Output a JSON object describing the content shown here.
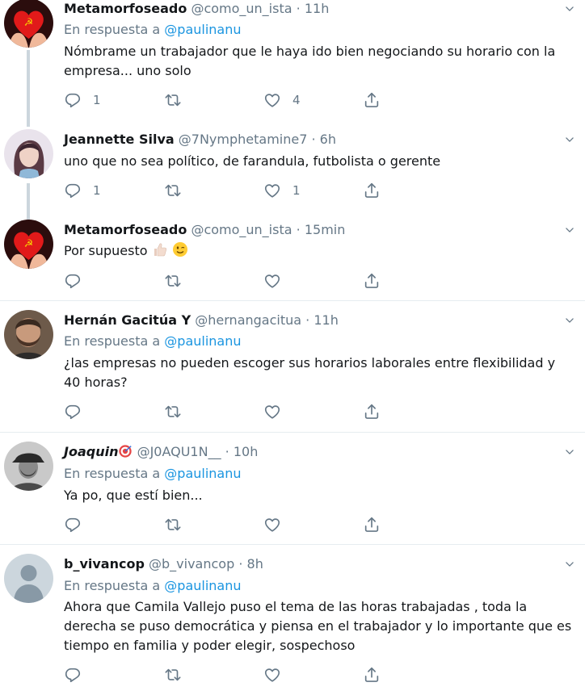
{
  "tweets": [
    {
      "name": "Metamorfoseado",
      "handle": "@como_un_ista",
      "dot": "·",
      "time": "11h",
      "reply_prefix": "En respuesta a",
      "reply_mention": "@paulinanu",
      "text": "Nómbrame un trabajador que le haya ido bien negociando su horario con la empresa... uno solo",
      "replies": "1",
      "retweets": "",
      "likes": "4"
    },
    {
      "name": "Jeannette Silva",
      "handle": "@7Nymphetamine7",
      "dot": "·",
      "time": "6h",
      "text": "uno que no sea político, de farandula, futbolista o gerente",
      "replies": "1",
      "retweets": "",
      "likes": "1"
    },
    {
      "name": "Metamorfoseado",
      "handle": "@como_un_ista",
      "dot": "·",
      "time": "15min",
      "text": "Por supuesto",
      "emojis": [
        "thumbs-up-emoji",
        "winking-face-emoji"
      ],
      "replies": "",
      "retweets": "",
      "likes": ""
    },
    {
      "name": "Hernán Gacitúa Y",
      "handle": "@hernangacitua",
      "dot": "·",
      "time": "11h",
      "reply_prefix": "En respuesta a",
      "reply_mention": "@paulinanu",
      "text": "¿las empresas no pueden escoger sus horarios laborales entre flexibilidad y 40 horas?",
      "replies": "",
      "retweets": "",
      "likes": ""
    },
    {
      "name": "Joaquin",
      "name_emoji": "target-emoji",
      "handle": "@J0AQU1N__",
      "dot": "·",
      "time": "10h",
      "reply_prefix": "En respuesta a",
      "reply_mention": "@paulinanu",
      "text": "Ya po, que estí bien...",
      "replies": "",
      "retweets": "",
      "likes": ""
    },
    {
      "name": "b_vivancop",
      "handle": "@b_vivancop",
      "dot": "·",
      "time": "8h",
      "reply_prefix": "En respuesta a",
      "reply_mention": "@paulinanu",
      "text": "Ahora que Camila Vallejo puso el tema de las horas trabajadas , toda la derecha se puso democrática y piensa en el trabajador y lo importante que es tiempo en familia y poder elegir, sospechoso",
      "replies": "",
      "retweets": "",
      "likes": ""
    }
  ],
  "icons": {
    "reply": "reply-icon",
    "retweet": "retweet-icon",
    "like": "heart-icon",
    "share": "share-icon",
    "caret": "chevron-down-icon"
  },
  "colors": {
    "text": "#14171a",
    "secondary": "#657786",
    "link": "#1b95e0",
    "thread_line": "#ccd6dd",
    "divider": "#e6ecf0"
  }
}
